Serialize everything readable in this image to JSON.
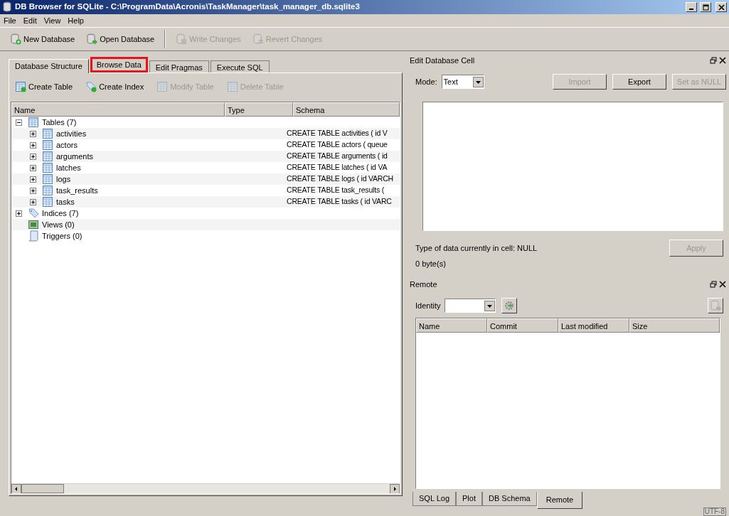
{
  "window": {
    "title": "DB Browser for SQLite - C:\\ProgramData\\Acronis\\TaskManager\\task_manager_db.sqlite3"
  },
  "menu": [
    "File",
    "Edit",
    "View",
    "Help"
  ],
  "toolbar": [
    {
      "label": "New Database",
      "kind": "new",
      "disabled": false
    },
    {
      "label": "Open Database",
      "kind": "open",
      "disabled": false
    },
    {
      "label": "Write Changes",
      "kind": "write",
      "disabled": true
    },
    {
      "label": "Revert Changes",
      "kind": "revert",
      "disabled": true
    }
  ],
  "tabs": [
    {
      "label": "Database Structure",
      "selected": true,
      "highlighted": false
    },
    {
      "label": "Browse Data",
      "selected": false,
      "highlighted": true
    },
    {
      "label": "Edit Pragmas",
      "selected": false,
      "highlighted": false
    },
    {
      "label": "Execute SQL",
      "selected": false,
      "highlighted": false
    }
  ],
  "structure_toolbar": [
    {
      "label": "Create Table",
      "kind": "table",
      "disabled": false
    },
    {
      "label": "Create Index",
      "kind": "index",
      "disabled": false
    },
    {
      "label": "Modify Table",
      "kind": "modify",
      "disabled": true
    },
    {
      "label": "Delete Table",
      "kind": "delete",
      "disabled": true
    }
  ],
  "tree": {
    "columns": [
      "Name",
      "Type",
      "Schema"
    ],
    "items": [
      {
        "name": "Tables (7)",
        "kind": "tables",
        "expanded": true,
        "children": [
          {
            "name": "activities",
            "kind": "table",
            "expanded": false,
            "schema": "CREATE TABLE activities ( id V"
          },
          {
            "name": "actors",
            "kind": "table",
            "expanded": false,
            "schema": "CREATE TABLE actors ( queue"
          },
          {
            "name": "arguments",
            "kind": "table",
            "expanded": false,
            "schema": "CREATE TABLE arguments ( id"
          },
          {
            "name": "latches",
            "kind": "table",
            "expanded": false,
            "schema": "CREATE TABLE latches ( id VA"
          },
          {
            "name": "logs",
            "kind": "table",
            "expanded": false,
            "schema": "CREATE TABLE logs ( id VARCH"
          },
          {
            "name": "task_results",
            "kind": "table",
            "expanded": false,
            "schema": "CREATE TABLE task_results ("
          },
          {
            "name": "tasks",
            "kind": "table",
            "expanded": false,
            "schema": "CREATE TABLE tasks ( id VARC"
          }
        ]
      },
      {
        "name": "Indices (7)",
        "kind": "indices",
        "expanded": false
      },
      {
        "name": "Views (0)",
        "kind": "views"
      },
      {
        "name": "Triggers (0)",
        "kind": "triggers"
      }
    ]
  },
  "edit_cell": {
    "title": "Edit Database Cell",
    "mode_label": "Mode:",
    "mode": "Text",
    "buttons": [
      {
        "label": "Import",
        "disabled": true
      },
      {
        "label": "Export",
        "disabled": false
      },
      {
        "label": "Set as NULL",
        "disabled": true
      }
    ],
    "type_info": "Type of data currently in cell: NULL",
    "size_info": "0 byte(s)",
    "apply": {
      "label": "Apply",
      "disabled": true
    }
  },
  "remote": {
    "title": "Remote",
    "identity_label": "Identity",
    "columns": [
      "Name",
      "Commit",
      "Last modified",
      "Size"
    ]
  },
  "bottom_tabs": [
    {
      "label": "SQL Log",
      "selected": false
    },
    {
      "label": "Plot",
      "selected": false
    },
    {
      "label": "DB Schema",
      "selected": false
    },
    {
      "label": "Remote",
      "selected": true
    }
  ],
  "status_bar": {
    "encoding": "UTF-8"
  }
}
